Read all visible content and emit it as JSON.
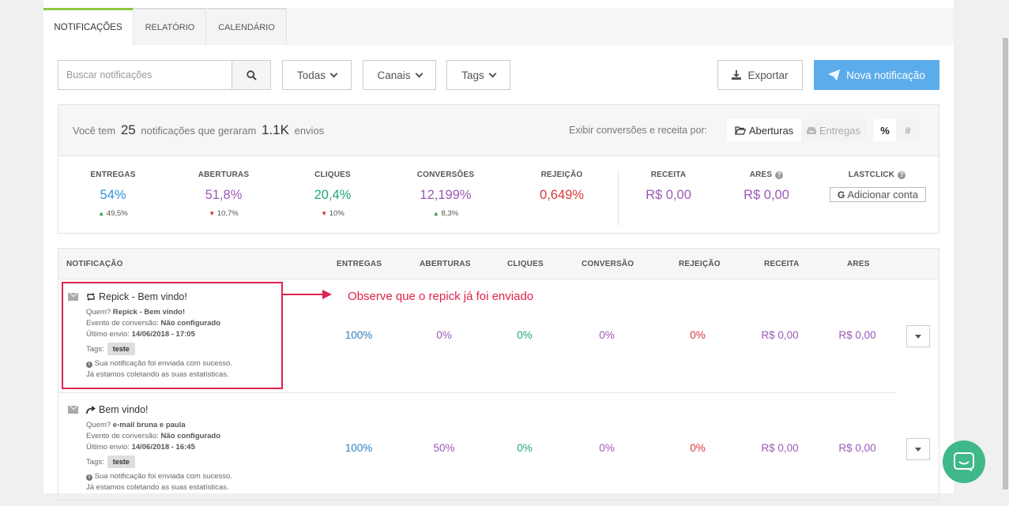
{
  "tabs": [
    {
      "label": "NOTIFICAÇÕES",
      "active": true
    },
    {
      "label": "RELATÓRIO",
      "active": false
    },
    {
      "label": "CALENDÁRIO",
      "active": false
    }
  ],
  "toolbar": {
    "search_placeholder": "Buscar notificações",
    "filter_all": "Todas",
    "filter_channels": "Canais",
    "filter_tags": "Tags",
    "export_label": "Exportar",
    "new_label": "Nova notificação"
  },
  "summary": {
    "prefix": "Você tem",
    "count": "25",
    "middle": "notificações que geraram",
    "sends": "1.1K",
    "suffix": "envios",
    "exibir_label": "Exibir conversões e receita por:",
    "opt_aberturas": "Aberturas",
    "opt_entregas": "Entregas",
    "opt_percent": "%",
    "opt_hash": "#"
  },
  "metrics": [
    {
      "label": "ENTREGAS",
      "value": "54%",
      "delta": "49,5%",
      "dir": "up",
      "color": "#2f95d8"
    },
    {
      "label": "ABERTURAS",
      "value": "51,8%",
      "delta": "10,7%",
      "dir": "down",
      "color": "#9b59b6"
    },
    {
      "label": "CLIQUES",
      "value": "20,4%",
      "delta": "10%",
      "dir": "down",
      "color": "#21a67a"
    },
    {
      "label": "CONVERSÕES",
      "value": "12,199%",
      "delta": "8,3%",
      "dir": "up",
      "color": "#9b59b6"
    },
    {
      "label": "REJEIÇÃO",
      "value": "0,649%",
      "delta": "",
      "dir": "",
      "color": "#d9383a"
    },
    {
      "label": "RECEITA",
      "value": "R$ 0,00",
      "delta": "",
      "dir": "",
      "color": "#9b59b6"
    },
    {
      "label": "ARES",
      "value": "R$ 0,00",
      "delta": "",
      "dir": "",
      "color": "#9b59b6"
    },
    {
      "label": "LASTCLICK",
      "value": "",
      "delta": "",
      "dir": "",
      "color": "#555"
    }
  ],
  "lastclick_button": "Adicionar conta",
  "table": {
    "headers": [
      "NOTIFICAÇÃO",
      "ENTREGAS",
      "ABERTURAS",
      "CLIQUES",
      "CONVERSÃO",
      "REJEIÇÃO",
      "RECEITA",
      "ARES"
    ],
    "rows": [
      {
        "title": "Repick - Bem vindo!",
        "icon": "repeat-icon",
        "quem_label": "Quem?",
        "quem": "Repick - Bem vindo!",
        "evento_label": "Evento de conversão:",
        "evento": "Não configurado",
        "ultimo_label": "Último envio:",
        "ultimo": "14/06/2018 - 17:05",
        "tags_label": "Tags:",
        "tag": "teste",
        "info1": "Sua notificação foi enviada com sucesso.",
        "info2": "Já estamos coletando as suas estatísticas.",
        "entregas": "100%",
        "aberturas": "0%",
        "cliques": "0%",
        "conversao": "0%",
        "rejeicao": "0%",
        "receita": "R$ 0,00",
        "ares": "R$ 0,00"
      },
      {
        "title": "Bem vindo!",
        "icon": "share-arrow-icon",
        "quem_label": "Quem?",
        "quem": "e-mail bruna e paula",
        "evento_label": "Evento de conversão:",
        "evento": "Não configurado",
        "ultimo_label": "Último envio:",
        "ultimo": "14/06/2018 - 16:45",
        "tags_label": "Tags:",
        "tag": "teste",
        "info1": "Sua notificação foi enviada com sucesso.",
        "info2": "Já estamos coletando as suas estatísticas.",
        "entregas": "100%",
        "aberturas": "50%",
        "cliques": "0%",
        "conversao": "0%",
        "rejeicao": "0%",
        "receita": "R$ 0,00",
        "ares": "R$ 0,00"
      }
    ]
  },
  "annotation": "Observe que o repick já foi enviado",
  "colors": {
    "accent": "#5bacea",
    "active_tab": "#8dc73f",
    "entregas": "#2f95d8",
    "purple": "#9b59b6",
    "green": "#21a67a",
    "red": "#d9383a",
    "annotation": "#e0234e",
    "chat": "#3fb88a"
  }
}
